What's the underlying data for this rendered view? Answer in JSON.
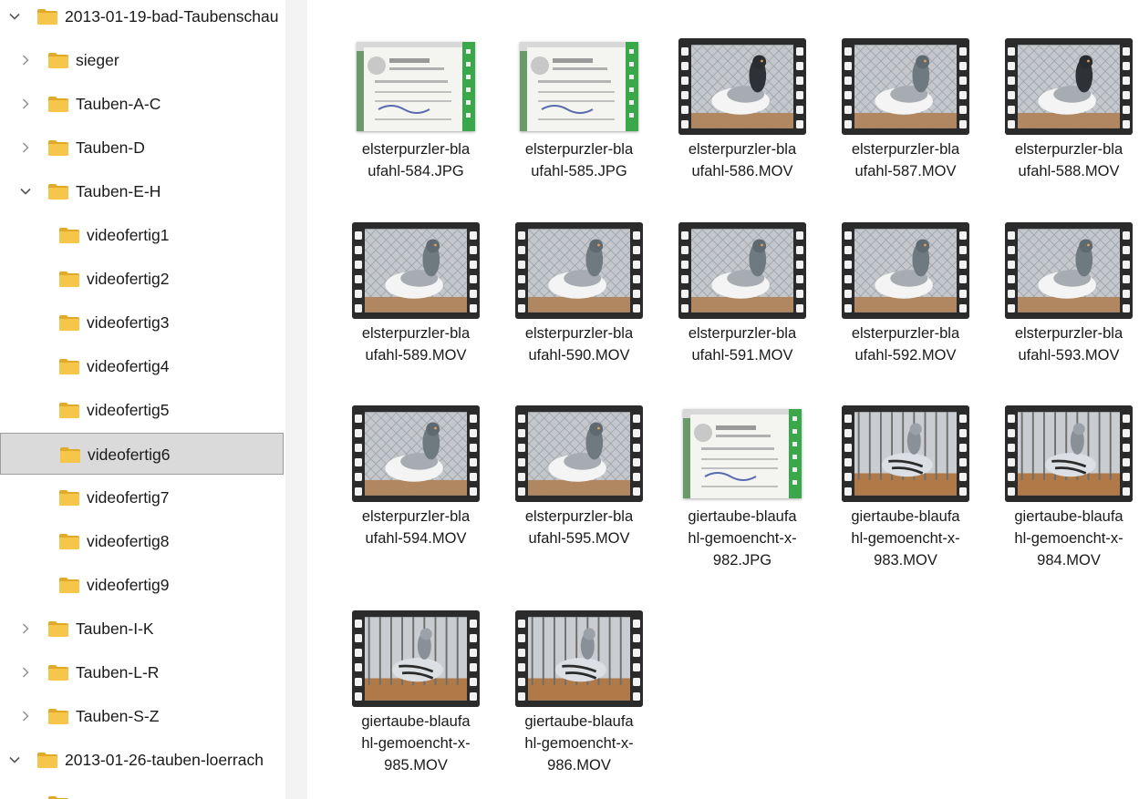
{
  "nav": {
    "items": [
      {
        "label": "2013-01-19-bad-Taubenschau",
        "level": 0,
        "chevron": "chevron-down",
        "selected": false
      },
      {
        "label": "sieger",
        "level": 1,
        "chevron": "chevron-right",
        "selected": false
      },
      {
        "label": "Tauben-A-C",
        "level": 1,
        "chevron": "chevron-right",
        "selected": false
      },
      {
        "label": "Tauben-D",
        "level": 1,
        "chevron": "chevron-right",
        "selected": false
      },
      {
        "label": "Tauben-E-H",
        "level": 1,
        "chevron": "chevron-down",
        "selected": false
      },
      {
        "label": "videofertig1",
        "level": 2,
        "chevron": "",
        "selected": false
      },
      {
        "label": "videofertig2",
        "level": 2,
        "chevron": "",
        "selected": false
      },
      {
        "label": "videofertig3",
        "level": 2,
        "chevron": "",
        "selected": false
      },
      {
        "label": "videofertig4",
        "level": 2,
        "chevron": "",
        "selected": false
      },
      {
        "label": "videofertig5",
        "level": 2,
        "chevron": "",
        "selected": false
      },
      {
        "label": "videofertig6",
        "level": 2,
        "chevron": "",
        "selected": true
      },
      {
        "label": "videofertig7",
        "level": 2,
        "chevron": "",
        "selected": false
      },
      {
        "label": "videofertig8",
        "level": 2,
        "chevron": "",
        "selected": false
      },
      {
        "label": "videofertig9",
        "level": 2,
        "chevron": "",
        "selected": false
      },
      {
        "label": "Tauben-I-K",
        "level": 1,
        "chevron": "chevron-right",
        "selected": false
      },
      {
        "label": "Tauben-L-R",
        "level": 1,
        "chevron": "chevron-right",
        "selected": false
      },
      {
        "label": "Tauben-S-Z",
        "level": 1,
        "chevron": "chevron-right",
        "selected": false
      },
      {
        "label": "2013-01-26-tauben-loerrach",
        "level": 0,
        "chevron": "chevron-down",
        "selected": false
      },
      {
        "label": "",
        "level": 1,
        "chevron": "",
        "selected": false
      }
    ]
  },
  "files": [
    {
      "lines": [
        "elsterpurzler-bla",
        "ufahl-584.JPG"
      ],
      "kind": "photo",
      "scene": "card"
    },
    {
      "lines": [
        "elsterpurzler-bla",
        "ufahl-585.JPG"
      ],
      "kind": "photo",
      "scene": "card"
    },
    {
      "lines": [
        "elsterpurzler-bla",
        "ufahl-586.MOV"
      ],
      "kind": "video",
      "scene": "dark"
    },
    {
      "lines": [
        "elsterpurzler-bla",
        "ufahl-587.MOV"
      ],
      "kind": "video",
      "scene": "light"
    },
    {
      "lines": [
        "elsterpurzler-bla",
        "ufahl-588.MOV"
      ],
      "kind": "video",
      "scene": "dark"
    },
    {
      "lines": [
        "elsterpurzler-bla",
        "ufahl-589.MOV"
      ],
      "kind": "video",
      "scene": "light"
    },
    {
      "lines": [
        "elsterpurzler-bla",
        "ufahl-590.MOV"
      ],
      "kind": "video",
      "scene": "light"
    },
    {
      "lines": [
        "elsterpurzler-bla",
        "ufahl-591.MOV"
      ],
      "kind": "video",
      "scene": "light"
    },
    {
      "lines": [
        "elsterpurzler-bla",
        "ufahl-592.MOV"
      ],
      "kind": "video",
      "scene": "light"
    },
    {
      "lines": [
        "elsterpurzler-bla",
        "ufahl-593.MOV"
      ],
      "kind": "video",
      "scene": "light"
    },
    {
      "lines": [
        "elsterpurzler-bla",
        "ufahl-594.MOV"
      ],
      "kind": "video",
      "scene": "light"
    },
    {
      "lines": [
        "elsterpurzler-bla",
        "ufahl-595.MOV"
      ],
      "kind": "video",
      "scene": "light"
    },
    {
      "lines": [
        "giertaube-blaufa",
        "hl-gemoencht-x-",
        "982.JPG"
      ],
      "kind": "photo",
      "scene": "card"
    },
    {
      "lines": [
        "giertaube-blaufa",
        "hl-gemoencht-x-",
        "983.MOV"
      ],
      "kind": "video",
      "scene": "bars"
    },
    {
      "lines": [
        "giertaube-blaufa",
        "hl-gemoencht-x-",
        "984.MOV"
      ],
      "kind": "video",
      "scene": "bars"
    },
    {
      "lines": [
        "giertaube-blaufa",
        "hl-gemoencht-x-",
        "985.MOV"
      ],
      "kind": "video",
      "scene": "bars"
    },
    {
      "lines": [
        "giertaube-blaufa",
        "hl-gemoencht-x-",
        "986.MOV"
      ],
      "kind": "video",
      "scene": "bars"
    }
  ],
  "colors": {
    "folder": "#f6c64a",
    "folder_dark": "#e0a92a",
    "selected_bg": "#dadada",
    "chevron": "#555555"
  }
}
